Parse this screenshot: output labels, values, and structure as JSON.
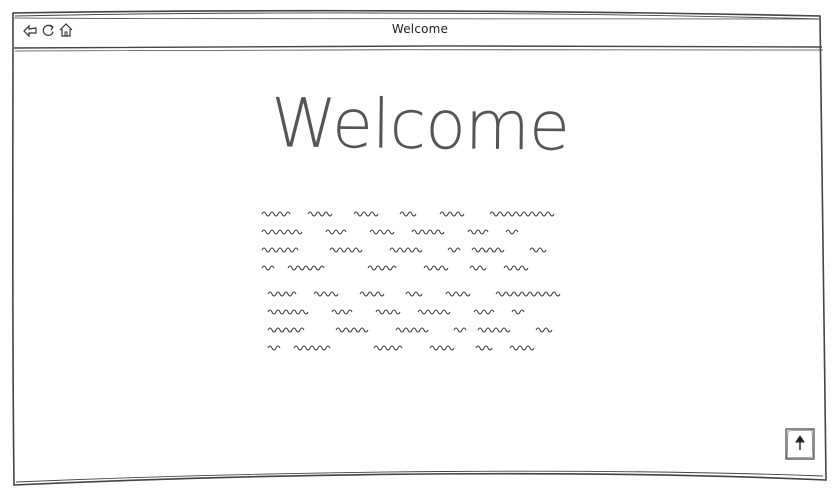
{
  "window": {
    "title": "Welcome"
  },
  "toolbar": {
    "icons": [
      "back-icon",
      "refresh-icon",
      "home-icon"
    ]
  },
  "content": {
    "heading": "Welcome",
    "paragraphs": [
      {
        "lines": 4
      },
      {
        "lines": 4
      }
    ]
  },
  "scroll_button": {
    "icon": "arrow-up-icon"
  },
  "colors": {
    "stroke": "#444444",
    "text": "#555555",
    "background": "#ffffff"
  }
}
